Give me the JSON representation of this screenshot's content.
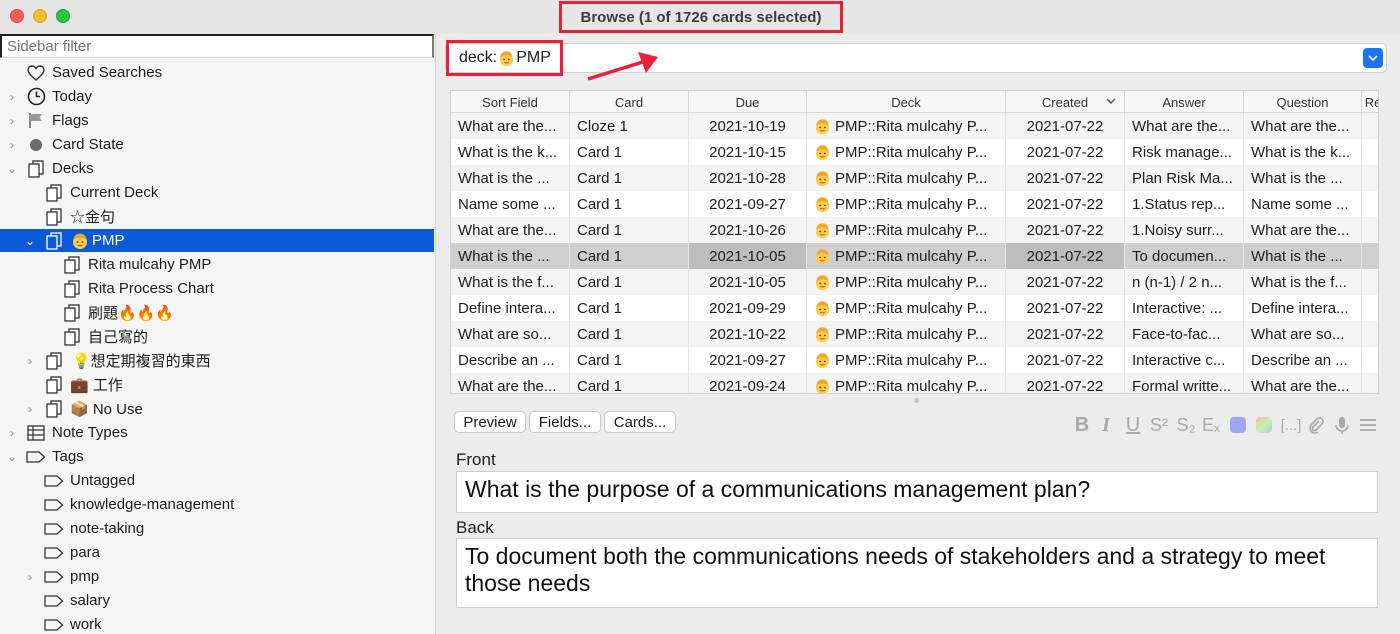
{
  "window": {
    "title": "Browse (1 of 1726 cards selected)"
  },
  "sidebar": {
    "filter_placeholder": "Sidebar filter",
    "items": [
      {
        "label": "Saved Searches"
      },
      {
        "label": "Today"
      },
      {
        "label": "Flags"
      },
      {
        "label": "Card State"
      },
      {
        "label": "Decks"
      },
      {
        "label": "Current Deck"
      },
      {
        "label": "☆金句"
      },
      {
        "label": "PMP"
      },
      {
        "label": "Rita mulcahy PMP"
      },
      {
        "label": "Rita Process Chart"
      },
      {
        "label": "刷題🔥🔥🔥"
      },
      {
        "label": "自己寫的"
      },
      {
        "label": "💡想定期複習的東西"
      },
      {
        "label": "💼 工作"
      },
      {
        "label": "📦 No Use"
      },
      {
        "label": "Note Types"
      },
      {
        "label": "Tags"
      },
      {
        "label": "Untagged"
      },
      {
        "label": "knowledge-management"
      },
      {
        "label": "note-taking"
      },
      {
        "label": "para"
      },
      {
        "label": "pmp"
      },
      {
        "label": "salary"
      },
      {
        "label": "work"
      }
    ]
  },
  "search": {
    "prefix": "deck:",
    "value": "PMP"
  },
  "table": {
    "columns": [
      "Sort Field",
      "Card",
      "Due",
      "Deck",
      "Created",
      "Answer",
      "Question",
      "Re"
    ],
    "sorted_column": "Created",
    "selected_row": 5,
    "rows": [
      [
        "What are the...",
        "Cloze 1",
        "2021-10-19",
        "PMP::Rita mulcahy P...",
        "2021-07-22",
        "What are the...",
        "What are the..."
      ],
      [
        "What is the k...",
        "Card 1",
        "2021-10-15",
        "PMP::Rita mulcahy P...",
        "2021-07-22",
        "Risk manage...",
        "What is the k..."
      ],
      [
        "What is the ...",
        "Card 1",
        "2021-10-28",
        "PMP::Rita mulcahy P...",
        "2021-07-22",
        "Plan Risk Ma...",
        "What is the ..."
      ],
      [
        "Name some ...",
        "Card 1",
        "2021-09-27",
        "PMP::Rita mulcahy P...",
        "2021-07-22",
        "1.Status rep...",
        "Name some ..."
      ],
      [
        "What are the...",
        "Card 1",
        "2021-10-26",
        "PMP::Rita mulcahy P...",
        "2021-07-22",
        "1.Noisy surr...",
        "What are the..."
      ],
      [
        "What is the ...",
        "Card 1",
        "2021-10-05",
        "PMP::Rita mulcahy P...",
        "2021-07-22",
        "To documen...",
        "What is the ..."
      ],
      [
        "What is the f...",
        "Card 1",
        "2021-10-05",
        "PMP::Rita mulcahy P...",
        "2021-07-22",
        "n (n-1) / 2  n...",
        "What is the f..."
      ],
      [
        "Define intera...",
        "Card 1",
        "2021-09-29",
        "PMP::Rita mulcahy P...",
        "2021-07-22",
        "Interactive: ...",
        "Define intera..."
      ],
      [
        "What are so...",
        "Card 1",
        "2021-10-22",
        "PMP::Rita mulcahy P...",
        "2021-07-22",
        "Face-to-fac...",
        "What are so..."
      ],
      [
        "Describe an ...",
        "Card 1",
        "2021-09-27",
        "PMP::Rita mulcahy P...",
        "2021-07-22",
        "Interactive c...",
        "Describe an ..."
      ],
      [
        "What are the...",
        "Card 1",
        "2021-09-24",
        "PMP::Rita mulcahy P...",
        "2021-07-22",
        "Formal writte...",
        "What are the..."
      ]
    ]
  },
  "editor": {
    "buttons": {
      "preview": "Preview",
      "fields": "Fields...",
      "cards": "Cards..."
    },
    "toolbar": {
      "bold": "B",
      "italic": "I",
      "underline": "U",
      "superscript": "S²",
      "subscript": "S₂",
      "clear": "Eₓ",
      "cloze": "[...]"
    },
    "front_label": "Front",
    "front_value": "What is the purpose of a communications management plan?",
    "back_label": "Back",
    "back_value": "To document both the communications needs of stakeholders and a strategy to meet those needs"
  },
  "colors": {
    "accent": "#0a5ad8",
    "highlight": "#e8203a"
  }
}
